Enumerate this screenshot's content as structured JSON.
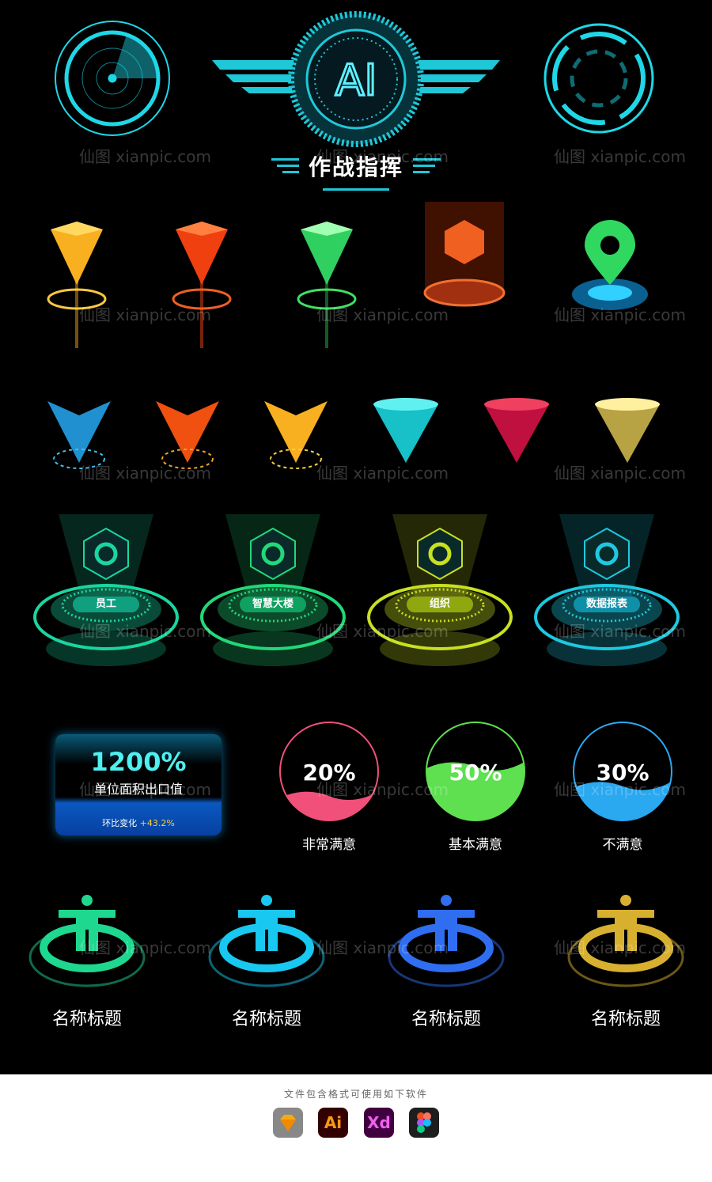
{
  "header": {
    "title": "作战指挥"
  },
  "platforms": [
    {
      "label": "员工",
      "color": "#19d6a0"
    },
    {
      "label": "智慧大楼",
      "color": "#22d878"
    },
    {
      "label": "组织",
      "color": "#c8e021"
    },
    {
      "label": "数据报表",
      "color": "#1ec8e0"
    }
  ],
  "stat_card": {
    "value": "1200%",
    "label": "单位面积出口值",
    "change_label": "环比变化",
    "change_value": "+43.2%"
  },
  "gauges": [
    {
      "value": "20%",
      "label": "非常满意",
      "level": 0.2,
      "color": "#f0507a"
    },
    {
      "value": "50%",
      "label": "基本满意",
      "level": 0.5,
      "color": "#5ee050"
    },
    {
      "value": "30%",
      "label": "不满意",
      "level": 0.3,
      "color": "#2aa8f0"
    }
  ],
  "persons": [
    {
      "label": "名称标题",
      "color": "#1ed890"
    },
    {
      "label": "名称标题",
      "color": "#18c8f0"
    },
    {
      "label": "名称标题",
      "color": "#2f6ef0"
    },
    {
      "label": "名称标题",
      "color": "#d8b030"
    }
  ],
  "footer": {
    "caption": "文件包含格式可使用如下软件",
    "apps": [
      "Sketch",
      "Ai",
      "Xd",
      "Figma"
    ]
  },
  "logo": {
    "text": "AI"
  },
  "watermark": "仙图 xianpic.com"
}
